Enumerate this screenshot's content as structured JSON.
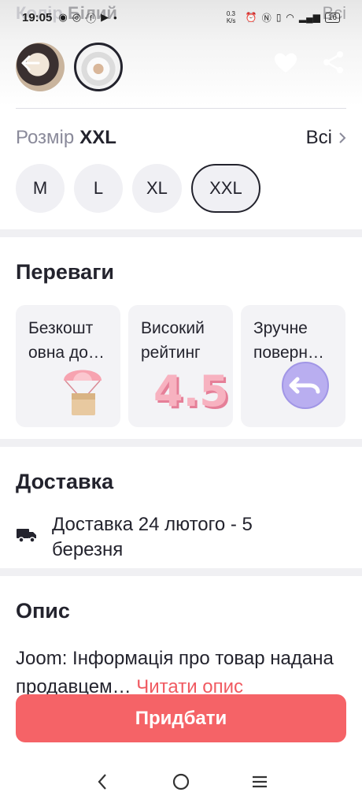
{
  "status_bar": {
    "time": "19:05",
    "speed": "0.3 K/s",
    "battery": "16"
  },
  "header_ghost": {
    "label": "Колір",
    "value": "Білий",
    "right": "Всі"
  },
  "size": {
    "label": "Розмір",
    "selected": "XXL",
    "all_label": "Всі",
    "options": [
      "M",
      "L",
      "XL",
      "XXL"
    ]
  },
  "benefits": {
    "title": "Переваги",
    "items": [
      {
        "text": "Безкошт овна до…",
        "icon": "parachute-box-icon"
      },
      {
        "text": "Високий рейтинг",
        "icon": "rating-icon",
        "rating": "4.5"
      },
      {
        "text": "Зручне поверн…",
        "icon": "return-arrow-icon"
      }
    ]
  },
  "delivery": {
    "title": "Доставка",
    "text": "Доставка 24 лютого - 5 березня",
    "icon": "truck-icon"
  },
  "description": {
    "title": "Опис",
    "text": "Joom: Інформація про товар надана продавцем… ",
    "read_more": "Читати опис"
  },
  "buy_button": "Придбати",
  "colors": {
    "accent": "#f56367",
    "link": "#f05a61",
    "text": "#23232d",
    "muted": "#8a8a9a"
  }
}
